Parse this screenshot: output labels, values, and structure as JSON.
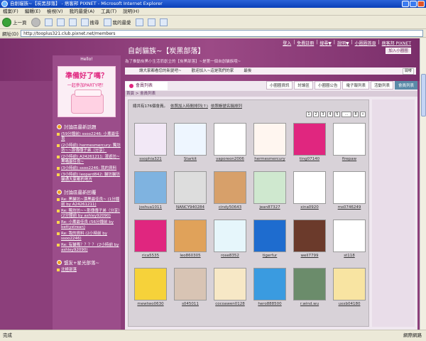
{
  "window": {
    "title": "自創貓族~【炭黑部落】 - 痞客邦 PIXNET - Microsoft Internet Explorer"
  },
  "menu": [
    "檔案(F)",
    "編輯(E)",
    "檢視(V)",
    "我的最愛(A)",
    "工具(T)",
    "說明(H)"
  ],
  "toolbar": {
    "back": "上一頁",
    "search": "搜尋",
    "favorites": "我的最愛"
  },
  "address": {
    "label": "網址(D)",
    "url": "http://tooplus321.club.pixnet.net/members"
  },
  "page": {
    "toplinks": [
      "登入",
      "免費註冊",
      "搜尋▼",
      "說明▼",
      "小圈圈首頁",
      "痞客邦 PIXNET"
    ],
    "join": "加入小圈圈",
    "title": "自創貓族~【炭黑部落】",
    "desc": "為了推動炭黑小生活而創立的【炭黑部落】~是第一個自創貓族哦~",
    "announcements": [
      "讓大家都看您的新變吧~",
      "歡迎加入~這是我們的家",
      "最後",
      "開喽"
    ],
    "ann_label": "開喽"
  },
  "sidebar": {
    "head": "Hello!",
    "promo": {
      "line1": "準備好了嗎？",
      "line2": "一起參加PARTY吧！"
    },
    "sections": [
      {
        "title": "討論區最新話題",
        "items": [
          "(59分鐘前) ssoo2246: 小薰最佳良",
          "(2小時前) hermesmercury: 獨坊坊~~那傳傳子弟（分享）",
          "(2小時前) A24261211: 漫遊坊~黑喵最佳良~",
          "(3小時前) ssoo2246: 我的資料",
          "(3小時前) leopard842: 貓坊貓坊貓通大家都的地方"
        ]
      },
      {
        "title": "討論區最新回覆",
        "items": [
          "Re: 黑貓坊~漂黑最佳良~ (1分鐘前 by A24261211)",
          "Re: 獨坊坊~~那傳傳子弟（分享）(2分鐘前 by ashley92090)",
          "Re: 小薰最佳良 (56分鐘前 by bettystrean)",
          "Re: 我的資料 (2小時前 by ssoo2246)",
          "Re: 有貓嗎？？？？ (2小時前 by ashley92090)"
        ]
      },
      {
        "title": "盟友+星光部落~",
        "items": [
          "北極部落"
        ]
      }
    ]
  },
  "main": {
    "title": "會員列表",
    "tabs": [
      "小圈圈資訊",
      "討論區",
      "小圈圈公告",
      "電子報列表",
      "活動列表",
      "會員列表"
    ],
    "crumb": "首頁 > 會員列表",
    "count": "總共有176個會員。",
    "link1": "依照加入時間排列(↑)",
    "link2": "依照帳號名稱排列",
    "pages": [
      "1",
      "2",
      "3",
      "4",
      "5",
      "...",
      "8",
      "»"
    ],
    "members": [
      {
        "name": "ssophia321",
        "color": "#f2e8f6"
      },
      {
        "name": "Starkit",
        "color": "#eef6ff"
      },
      {
        "name": "vaporeon2006",
        "color": "#fff"
      },
      {
        "name": "hermesmercury",
        "color": "#fff6f0"
      },
      {
        "name": "ting07140",
        "color": "#e0267f"
      },
      {
        "name": "firepaw",
        "color": "#fff"
      },
      {
        "name": "joshua1011",
        "color": "#7fb3e0"
      },
      {
        "name": "NANCY940284",
        "color": "#ddd"
      },
      {
        "name": "cindy50643",
        "color": "#d7a06a"
      },
      {
        "name": "jean87327",
        "color": "#cfe8cf"
      },
      {
        "name": "xina0920",
        "color": "#fff"
      },
      {
        "name": "ms0746249",
        "color": "#fff"
      },
      {
        "name": "rica5535",
        "color": "#e0267f"
      },
      {
        "name": "leo860305",
        "color": "#e0a25a"
      },
      {
        "name": "rose8352",
        "color": "#e6f6fb"
      },
      {
        "name": "tigerfur",
        "color": "#1e6ccf"
      },
      {
        "name": "well7799",
        "color": "#6b3a2b"
      },
      {
        "name": "st118",
        "color": "#fff"
      },
      {
        "name": "mewtwo0630",
        "color": "#f6d23a"
      },
      {
        "name": "s045011",
        "color": "#d8c4b4"
      },
      {
        "name": "cocoawen0128",
        "color": "#f7e8c6"
      },
      {
        "name": "hero888500",
        "color": "#3a9be0"
      },
      {
        "name": "r.wind.wu",
        "color": "#6b8c6b"
      },
      {
        "name": "uxxb04180",
        "color": "#f8e4a2"
      }
    ]
  },
  "status": {
    "left": "完成",
    "zone": "網際網路"
  }
}
